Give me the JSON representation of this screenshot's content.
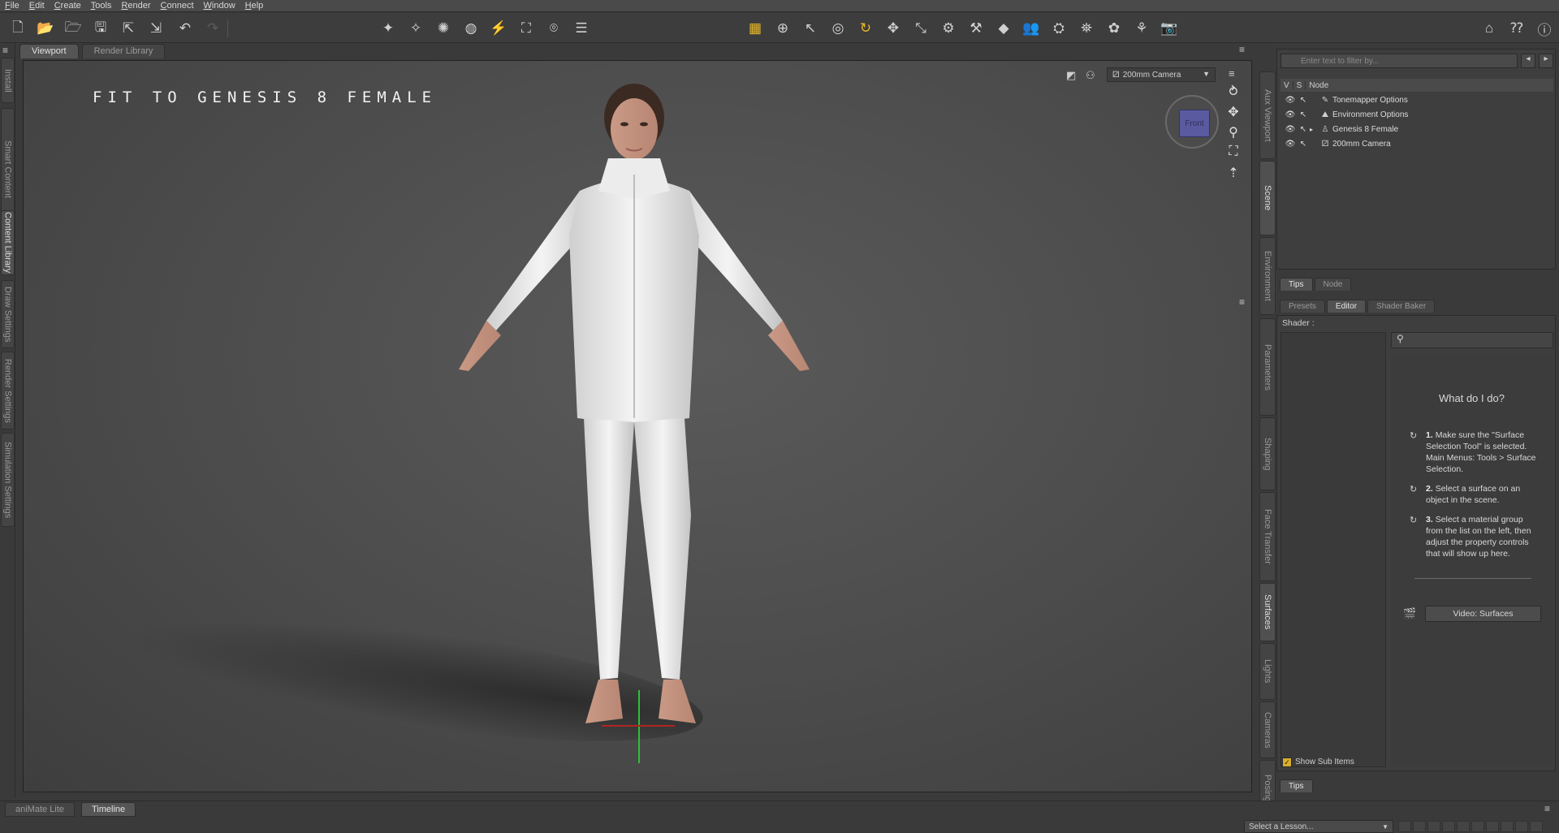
{
  "menu": [
    "File",
    "Edit",
    "Create",
    "Tools",
    "Render",
    "Connect",
    "Window",
    "Help"
  ],
  "viewport_tabs": [
    {
      "label": "Viewport",
      "active": true
    },
    {
      "label": "Render Library",
      "active": false
    }
  ],
  "viewport": {
    "title": "FIT TO GENESIS 8 FEMALE",
    "camera": "200mm Camera",
    "cube_label": "Front"
  },
  "left_tabs": [
    "Install",
    "Smart Content",
    "Content Library",
    "Draw Settings",
    "Render Settings",
    "Simulation Settings"
  ],
  "right_tabs_top": [
    "Aux Viewport",
    "Scene",
    "Environment"
  ],
  "right_tabs_bottom": [
    "Parameters",
    "Shaping",
    "Face Transfer",
    "Surfaces",
    "Lights",
    "Cameras",
    "Posing"
  ],
  "scene": {
    "filter_placeholder": "Enter text to filter by...",
    "col_v": "V",
    "col_s": "S",
    "col_node": "Node",
    "nodes": [
      "Tonemapper Options",
      "Environment Options",
      "Genesis 8 Female",
      "200mm Camera"
    ],
    "bottom_tabs": [
      "Tips",
      "Node"
    ]
  },
  "surfaces": {
    "tabs": [
      "Presets",
      "Editor",
      "Shader Baker"
    ],
    "shader_label": "Shader :",
    "help_title": "What do I do?",
    "steps": [
      {
        "num": "1.",
        "text": "Make sure the \"Surface Selection Tool\" is selected. Main Menus: Tools > Surface Selection."
      },
      {
        "num": "2.",
        "text": "Select a surface on an object in the scene."
      },
      {
        "num": "3.",
        "text": "Select a material group from the list on the left, then adjust the property controls that will show up here."
      }
    ],
    "video_button": "Video: Surfaces",
    "show_sub_items": "Show Sub Items",
    "bottom_tab": "Tips"
  },
  "bottom": {
    "tabs": [
      {
        "label": "aniMate Lite",
        "active": false
      },
      {
        "label": "Timeline",
        "active": true
      }
    ],
    "lesson_placeholder": "Select a Lesson..."
  }
}
